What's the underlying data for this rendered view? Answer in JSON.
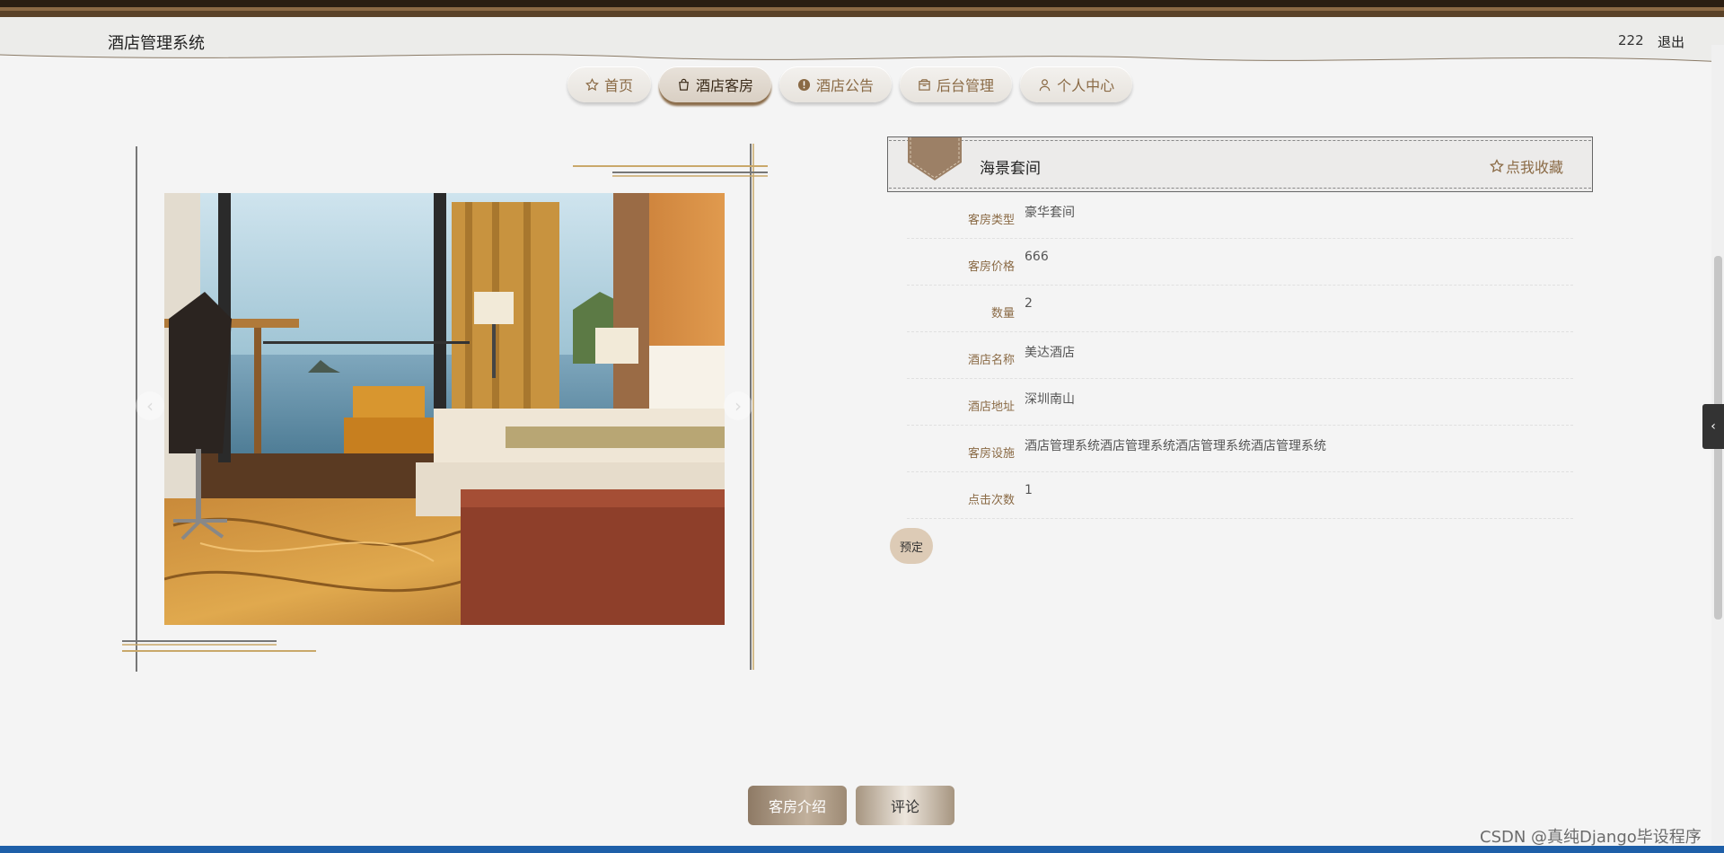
{
  "header": {
    "site_title": "酒店管理系统",
    "user_name": "222",
    "logout_label": "退出"
  },
  "nav": {
    "items": [
      {
        "label": "首页",
        "icon": "star-outline-icon"
      },
      {
        "label": "酒店客房",
        "icon": "shopping-bag-icon",
        "active": true
      },
      {
        "label": "酒店公告",
        "icon": "alert-circle-icon"
      },
      {
        "label": "后台管理",
        "icon": "box-icon"
      },
      {
        "label": "个人中心",
        "icon": "user-icon"
      }
    ]
  },
  "room": {
    "name": "海景套间",
    "favorite_label": "点我收藏",
    "fields": [
      {
        "label": "客房类型",
        "value": "豪华套间"
      },
      {
        "label": "客房价格",
        "value": "666"
      },
      {
        "label": "数量",
        "value": "2"
      },
      {
        "label": "酒店名称",
        "value": "美达酒店"
      },
      {
        "label": "酒店地址",
        "value": "深圳南山"
      },
      {
        "label": "客房设施",
        "value": "酒店管理系统酒店管理系统酒店管理系统酒店管理系统"
      },
      {
        "label": "点击次数",
        "value": "1"
      }
    ],
    "book_label": "预定"
  },
  "tabs": {
    "intro_label": "客房介绍",
    "review_label": "评论"
  },
  "gallery": {
    "prev_icon": "chevron-left-icon",
    "next_icon": "chevron-right-icon"
  },
  "watermark": "CSDN @真纯Django毕设程序",
  "colors": {
    "accent": "#8a6a45",
    "dark_bar": "#2b1e12",
    "button_bg": "#ddcbb6"
  }
}
